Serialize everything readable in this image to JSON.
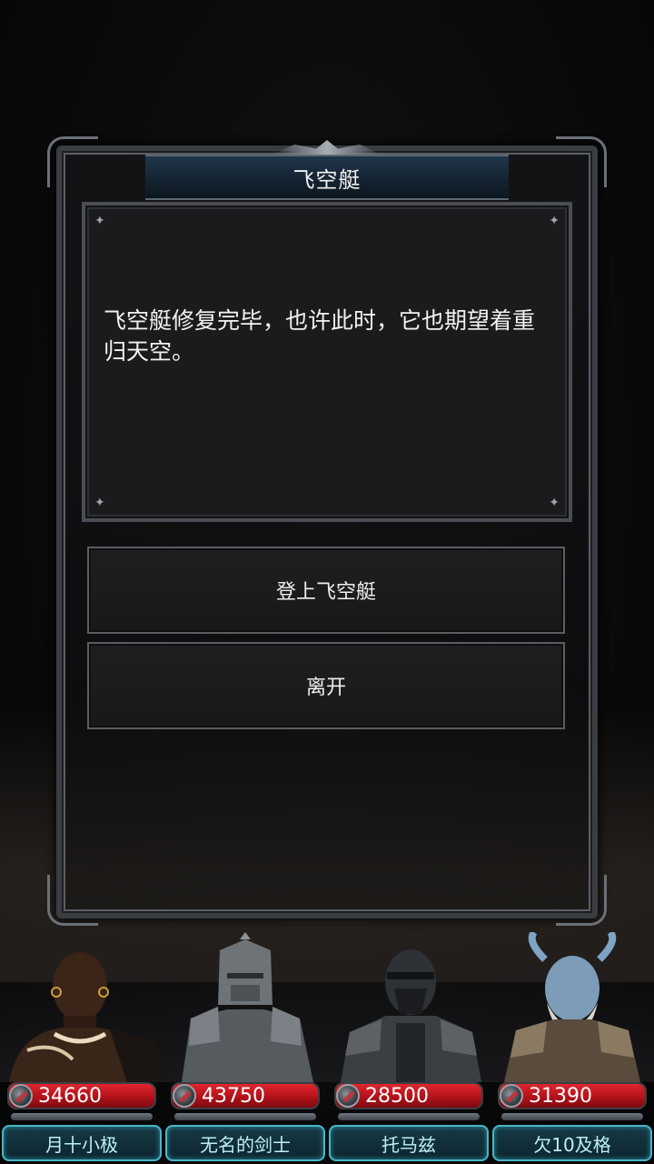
{
  "dialog": {
    "title": "飞空艇",
    "message": "飞空艇修复完毕，也许此时，它也期望着重归天空。",
    "choices": [
      {
        "label": "登上飞空艇"
      },
      {
        "label": "离开"
      }
    ]
  },
  "party": [
    {
      "name": "月十小极",
      "hp": "34660"
    },
    {
      "name": "无名的剑士",
      "hp": "43750"
    },
    {
      "name": "托马兹",
      "hp": "28500"
    },
    {
      "name": "欠10及格",
      "hp": "31390"
    }
  ],
  "colors": {
    "hp_bar": "#c9161f",
    "name_border": "#49b5c6",
    "title_bar": "#1a2d3d"
  }
}
